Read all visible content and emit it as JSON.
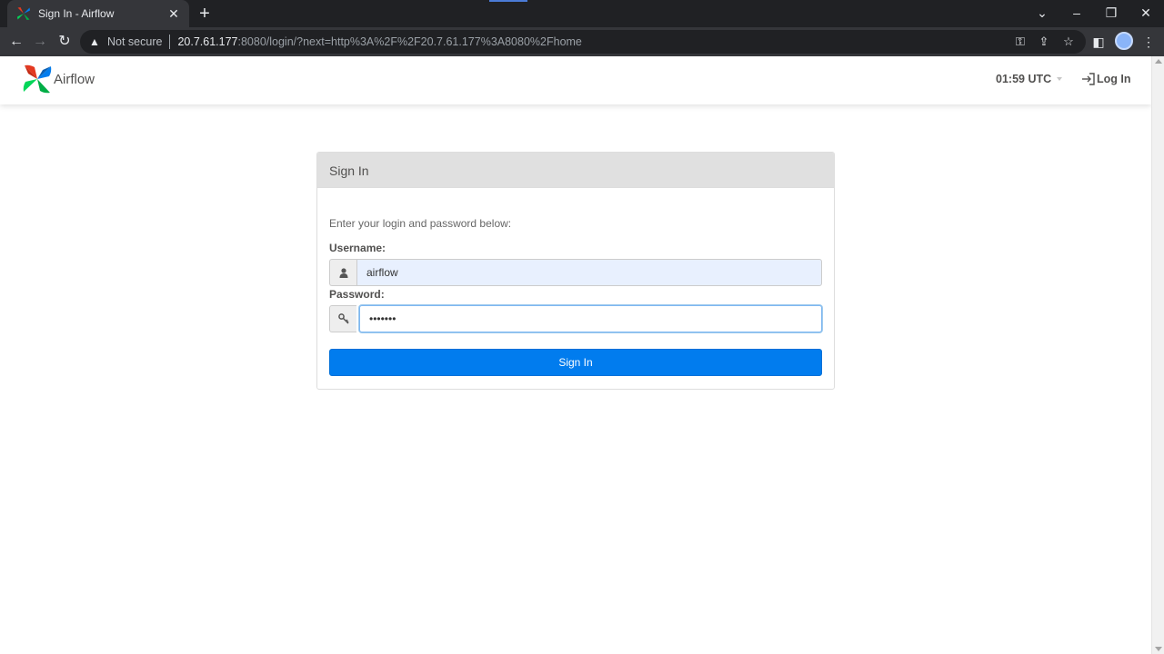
{
  "browser": {
    "tab_title": "Sign In - Airflow",
    "tab_close_glyph": "✕",
    "new_tab_glyph": "+",
    "omnibox": {
      "security_label": "Not secure",
      "url_host": "20.7.61.177",
      "url_rest": ":8080/login/?next=http%3A%2F%2F20.7.61.177%3A8080%2Fhome"
    },
    "icons": [
      "back-icon",
      "forward-icon",
      "reload-icon",
      "warning-icon",
      "key-icon",
      "share-icon",
      "star-icon",
      "side-panel-icon",
      "profile-avatar",
      "menu-icon",
      "minimize-icon",
      "restore-icon",
      "close-icon",
      "tab-search-icon"
    ]
  },
  "navbar": {
    "brand": "Airflow",
    "clock": "01:59 UTC",
    "login_label": "Log In"
  },
  "login": {
    "heading": "Sign In",
    "hint": "Enter your login and password below:",
    "username_label": "Username:",
    "username_value": "airflow",
    "password_label": "Password:",
    "password_value": "•••••••",
    "submit_label": "Sign In"
  },
  "colors": {
    "primary_button": "#017cee",
    "autofill_bg": "#e8f0fe",
    "panel_heading_bg": "#e0e0e0",
    "text": "#51504f"
  }
}
